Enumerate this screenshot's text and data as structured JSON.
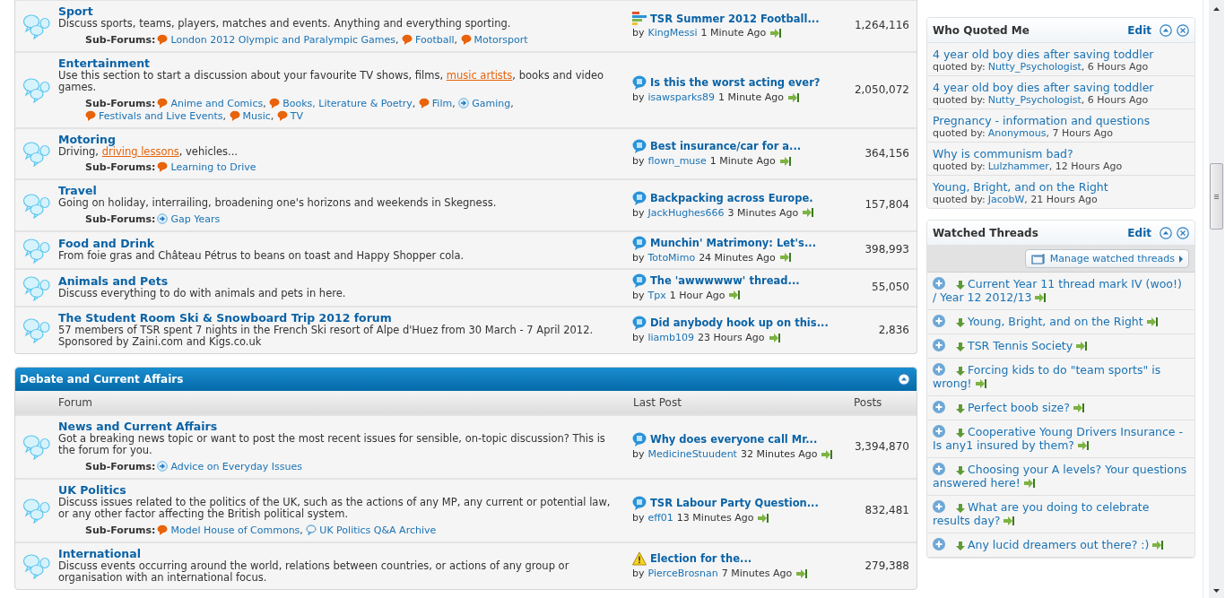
{
  "forum_sections": [
    {
      "rows": [
        {
          "title": "Sport",
          "description": [
            {
              "kind": "text",
              "text": "Discuss sports, teams, players, matches and events. Anything and everything sporting."
            }
          ],
          "sub_forums_label": "Sub-Forums:",
          "sub_forums": [
            {
              "kind": "bubble",
              "name": "London 2012 Olympic and Paralympic Games",
              "trailing": ","
            },
            {
              "kind": "bubble",
              "name": "Football",
              "trailing": ","
            },
            {
              "kind": "bubble",
              "name": "Motorsport"
            }
          ],
          "last_post": {
            "kind": "poll",
            "title": "TSR Summer 2012 Football...",
            "prefix": "by",
            "user": "KingMessi",
            "time": "1 Minute Ago"
          },
          "posts": "1,264,116"
        },
        {
          "title": "Entertainment",
          "description": [
            {
              "kind": "text",
              "text": "Use this section to start a discussion about your favourite TV shows, films, "
            },
            {
              "kind": "link",
              "text": "music artists"
            },
            {
              "kind": "text",
              "text": ", books and video games."
            }
          ],
          "sub_forums_label": "Sub-Forums:",
          "sub_forums": [
            {
              "kind": "bubble",
              "name": "Anime and Comics",
              "trailing": ","
            },
            {
              "kind": "bubble",
              "name": "Books, Literature & Poetry",
              "trailing": ","
            },
            {
              "kind": "bubble",
              "name": "Film",
              "trailing": ","
            },
            {
              "kind": "redirect",
              "name": "Gaming",
              "trailing": ","
            },
            {
              "kind": "bubble",
              "name": "Festivals and Live Events",
              "trailing": ","
            },
            {
              "kind": "bubble",
              "name": "Music",
              "trailing": ","
            },
            {
              "kind": "bubble",
              "name": "TV"
            }
          ],
          "last_post": {
            "kind": "thread",
            "title": "Is this the worst acting ever?",
            "prefix": "by",
            "user": "isawsparks89",
            "time": "1 Minute Ago"
          },
          "posts": "2,050,072"
        },
        {
          "title": "Motoring",
          "description": [
            {
              "kind": "text",
              "text": "Driving, "
            },
            {
              "kind": "link",
              "text": "driving lessons"
            },
            {
              "kind": "text",
              "text": ", vehicles..."
            }
          ],
          "sub_forums_label": "Sub-Forums:",
          "sub_forums": [
            {
              "kind": "bubble",
              "name": "Learning to Drive"
            }
          ],
          "last_post": {
            "kind": "thread",
            "title": "Best insurance/car for a...",
            "prefix": "by",
            "user": "flown_muse",
            "time": "1 Minute Ago"
          },
          "posts": "364,156"
        },
        {
          "title": "Travel",
          "description": [
            {
              "kind": "text",
              "text": "Going on holiday, interrailing, broadening one's horizons and weekends in Skegness."
            }
          ],
          "sub_forums_label": "Sub-Forums:",
          "sub_forums": [
            {
              "kind": "redirect",
              "name": "Gap Years"
            }
          ],
          "last_post": {
            "kind": "thread",
            "title": "Backpacking across Europe.",
            "prefix": "by",
            "user": "JackHughes666",
            "time": "3 Minutes Ago"
          },
          "posts": "157,804"
        },
        {
          "title": "Food and Drink",
          "description": [
            {
              "kind": "text",
              "text": "From foie gras and Château Pétrus to beans on toast and Happy Shopper cola."
            }
          ],
          "last_post": {
            "kind": "thread",
            "title": "Munchin' Matrimony: Let's...",
            "prefix": "by",
            "user": "TotoMimo",
            "time": "24 Minutes Ago"
          },
          "posts": "398,993"
        },
        {
          "title": "Animals and Pets",
          "description": [
            {
              "kind": "text",
              "text": "Discuss everything to do with animals and pets in here."
            }
          ],
          "last_post": {
            "kind": "thread",
            "title": "The 'awwwwww' thread...",
            "prefix": "by",
            "user": "Tpx",
            "time": "1 Hour Ago"
          },
          "posts": "55,050"
        },
        {
          "title": "The Student Room Ski & Snowboard Trip 2012 forum",
          "description": [
            {
              "kind": "text",
              "text": "57 members of TSR spent 7 nights in the French Ski resort of Alpe d'Huez from 30 March - 7 April 2012. Sponsored by Zaini.com and Kigs.co.uk"
            }
          ],
          "last_post": {
            "kind": "thread",
            "title": "Did anybody hook up on this...",
            "prefix": "by",
            "user": "liamb109",
            "time": "23 Hours Ago"
          },
          "posts": "2,836"
        }
      ]
    },
    {
      "title": "Debate and Current Affairs",
      "columns": [
        "Forum",
        "Last Post",
        "Posts"
      ],
      "rows": [
        {
          "title": "News and Current Affairs",
          "description": [
            {
              "kind": "text",
              "text": "Got a breaking news topic or want to post the most recent issues for sensible, on-topic discussion? This is the forum for you."
            }
          ],
          "sub_forums_label": "Sub-Forums:",
          "sub_forums": [
            {
              "kind": "redirect",
              "name": "Advice on Everyday Issues"
            }
          ],
          "last_post": {
            "kind": "thread",
            "title": "Why does everyone call Mr...",
            "prefix": "by",
            "user": "MedicineStuudent",
            "time": "32 Minutes Ago"
          },
          "posts": "3,394,870"
        },
        {
          "title": "UK Politics",
          "description": [
            {
              "kind": "text",
              "text": "Discuss issues related to the politics of the UK, such as the actions of any MP, any current or potential law, or any other factor affecting the British political system."
            }
          ],
          "sub_forums_label": "Sub-Forums:",
          "sub_forums": [
            {
              "kind": "bubble",
              "name": "Model House of Commons",
              "trailing": ","
            },
            {
              "kind": "outline",
              "name": "UK Politics Q&A Archive"
            }
          ],
          "last_post": {
            "kind": "thread",
            "title": "TSR Labour Party Question...",
            "prefix": "by",
            "user": "eff01",
            "time": "13 Minutes Ago"
          },
          "posts": "832,481"
        },
        {
          "title": "International",
          "description": [
            {
              "kind": "text",
              "text": "Discuss events occurring around the world, relations between countries, or actions of any group or organisation with an international focus."
            }
          ],
          "last_post": {
            "kind": "warning",
            "title": "Election for the...",
            "prefix": "by",
            "user": "PierceBrosnan",
            "time": "7 Minutes Ago"
          },
          "posts": "279,388"
        }
      ]
    }
  ],
  "who_quoted_me": {
    "title": "Who Quoted Me",
    "edit": "Edit",
    "items": [
      {
        "title": "4 year old boy dies after saving toddler",
        "prefix": "quoted by:",
        "user": "Nutty_Psychologist",
        "rest": ", 6 Hours Ago"
      },
      {
        "title": "4 year old boy dies after saving toddler",
        "prefix": "quoted by:",
        "user": "Nutty_Psychologist",
        "rest": ", 6 Hours Ago"
      },
      {
        "title": "Pregnancy - information and questions",
        "prefix": "quoted by:",
        "user": "Anonymous",
        "rest": ", 7 Hours Ago"
      },
      {
        "title": "Why is communism bad?",
        "prefix": "quoted by:",
        "user": "Lulzhammer",
        "rest": ", 12 Hours Ago"
      },
      {
        "title": "Young, Bright, and on the Right",
        "prefix": "quoted by:",
        "user": "JacobW",
        "rest": ", 21 Hours Ago"
      }
    ]
  },
  "watched_threads": {
    "title": "Watched Threads",
    "edit": "Edit",
    "manage_button": "Manage watched threads",
    "items": [
      {
        "title": "Current Year 11 thread mark IV (woo!) / Year 12 2012/13"
      },
      {
        "title": "Young, Bright, and on the Right"
      },
      {
        "title": "TSR Tennis Society"
      },
      {
        "title": "Forcing kids to do \"team sports\" is wrong!"
      },
      {
        "title": "Perfect boob size?"
      },
      {
        "title": "Cooperative Young Drivers Insurance - Is any1 insured by them?"
      },
      {
        "title": "Choosing your A levels? Your questions answered here!"
      },
      {
        "title": "What are you doing to celebrate results day?"
      },
      {
        "title": "Any lucid dreamers out there? :)"
      }
    ]
  }
}
